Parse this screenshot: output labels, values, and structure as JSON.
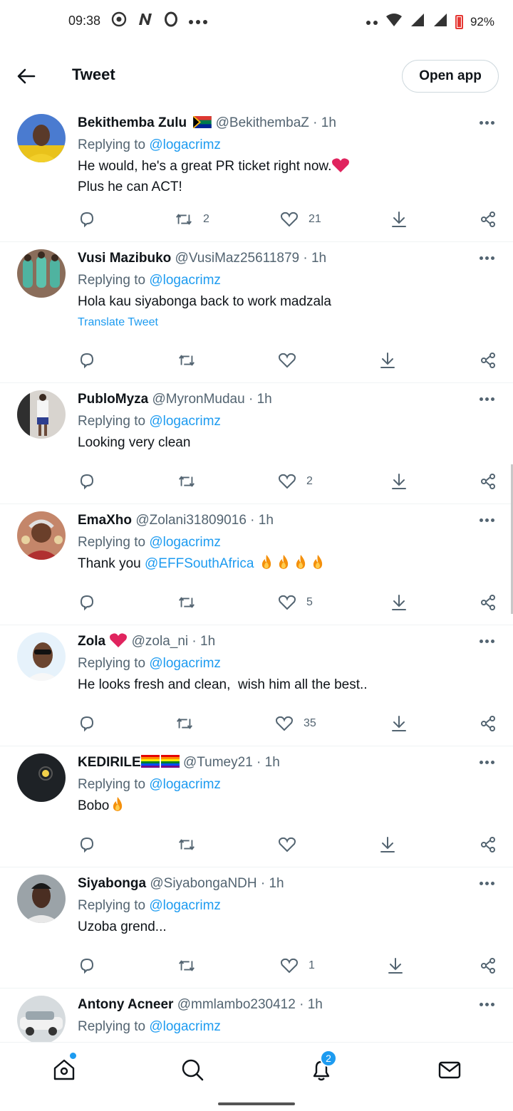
{
  "status_bar": {
    "time": "09:38",
    "battery": "92%",
    "left_icons": [
      "chrome-icon",
      "n-icon",
      "opera-icon",
      "more-dots-icon"
    ],
    "right_icons": [
      "dots-icon",
      "wifi-icon",
      "signal-icon",
      "signal-icon",
      "battery-icon"
    ]
  },
  "header": {
    "title": "Tweet",
    "open_app": "Open app"
  },
  "tweets": [
    {
      "name": "Bekithemba Zulu",
      "handle": "@BekithembaZ · 1h",
      "replying": "Replying to",
      "reply_to": "@logacrimz",
      "text_lines": [
        "He would, he's a great PR ticket right now.",
        "Plus he can ACT!"
      ],
      "retweets": "2",
      "likes": "21"
    },
    {
      "name": "Vusi Mazibuko",
      "handle": "@VusiMaz25611879 · 1h",
      "replying": "Replying to",
      "reply_to": "@logacrimz",
      "text": "Hola kau siyabonga back to work madzala",
      "translate": "Translate Tweet",
      "retweets": "",
      "likes": ""
    },
    {
      "name": "PubloMyza",
      "handle": "@MyronMudau · 1h",
      "replying": "Replying to",
      "reply_to": "@logacrimz",
      "text": "Looking very clean",
      "retweets": "",
      "likes": "2"
    },
    {
      "name": "EmaXho",
      "handle": "@Zolani31809016 · 1h",
      "replying": "Replying to",
      "reply_to": "@logacrimz",
      "text": "Thank you",
      "mention": "@EFFSouthAfrica",
      "retweets": "",
      "likes": "5"
    },
    {
      "name": "Zola",
      "handle": "@zola_ni · 1h",
      "replying": "Replying to",
      "reply_to": "@logacrimz",
      "text": "He looks fresh and clean,  wish him all the best..",
      "retweets": "",
      "likes": "35"
    },
    {
      "name": "KEDIRILE",
      "handle": "@Tumey21 · 1h",
      "replying": "Replying to",
      "reply_to": "@logacrimz",
      "text": "Bobo",
      "retweets": "",
      "likes": ""
    },
    {
      "name": "Siyabonga",
      "handle": "@SiyabongaNDH · 1h",
      "replying": "Replying to",
      "reply_to": "@logacrimz",
      "text": "Uzoba grend...",
      "retweets": "",
      "likes": "1"
    },
    {
      "name": "Antony Acneer",
      "handle": "@mmlambo230412 · 1h",
      "replying": "Replying to",
      "reply_to": "@logacrimz"
    }
  ],
  "bottom_nav": {
    "items": [
      "home-icon",
      "search-icon",
      "notifications-icon",
      "messages-icon"
    ],
    "notifications_badge": "2"
  },
  "colors": {
    "accent": "#1d9bf0",
    "text_primary": "#0f1419",
    "text_secondary": "#536471",
    "divider": "#eff3f4"
  }
}
